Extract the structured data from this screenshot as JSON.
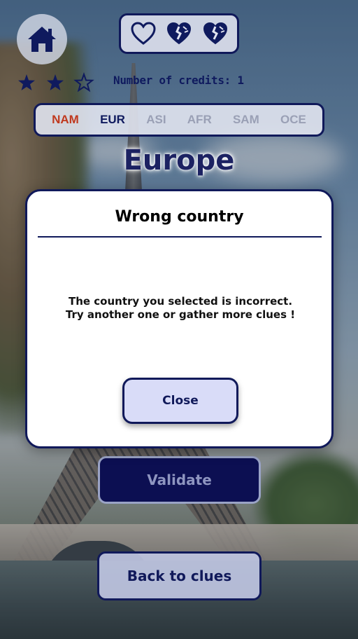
{
  "header": {
    "home_icon": "home-icon",
    "lives": [
      {
        "state": "empty",
        "icon": "heart-outline-icon"
      },
      {
        "state": "broken",
        "icon": "heart-broken-icon"
      },
      {
        "state": "broken",
        "icon": "heart-broken-icon"
      }
    ],
    "stars": [
      {
        "state": "filled",
        "icon": "star-filled-icon"
      },
      {
        "state": "filled",
        "icon": "star-filled-icon"
      },
      {
        "state": "empty",
        "icon": "star-outline-icon"
      }
    ],
    "credits_label": "Number of credits: 1"
  },
  "regions": {
    "tabs": [
      {
        "label": "NAM",
        "state": "completed",
        "color": "#c0391e"
      },
      {
        "label": "EUR",
        "state": "active",
        "color": "#0f1a5e"
      },
      {
        "label": "ASI",
        "state": "locked",
        "color": "#9aa0b5"
      },
      {
        "label": "AFR",
        "state": "locked",
        "color": "#9aa0b5"
      },
      {
        "label": "SAM",
        "state": "locked",
        "color": "#9aa0b5"
      },
      {
        "label": "OCE",
        "state": "locked",
        "color": "#9aa0b5"
      }
    ],
    "current_title": "Europe"
  },
  "modal": {
    "title": "Wrong country",
    "message_line1": "The country you selected is incorrect.",
    "message_line2": "Try another one or gather more clues !",
    "close_label": "Close"
  },
  "actions": {
    "validate_label": "Validate",
    "back_label": "Back to clues"
  },
  "colors": {
    "primary_navy": "#10195a",
    "accent_red": "#c0391e",
    "modal_button_bg": "#d9dcf8"
  }
}
